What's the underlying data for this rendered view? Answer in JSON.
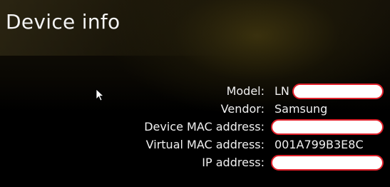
{
  "header": {
    "title": "Device info"
  },
  "device_info": {
    "rows": [
      {
        "label": "Model:",
        "value": "LN",
        "redacted": true
      },
      {
        "label": "Vendor:",
        "value": "Samsung",
        "redacted": false
      },
      {
        "label": "Device MAC address:",
        "value": "",
        "redacted": true
      },
      {
        "label": "Virtual MAC address:",
        "value": "001A799B3E8C",
        "redacted": false
      },
      {
        "label": "IP address:",
        "value": "",
        "redacted": true
      }
    ]
  },
  "icons": {
    "pointer": "mouse-pointer-icon"
  },
  "colors": {
    "text": "#ffffff",
    "redaction_border": "#e0202a",
    "redaction_fill": "#ffffff"
  }
}
